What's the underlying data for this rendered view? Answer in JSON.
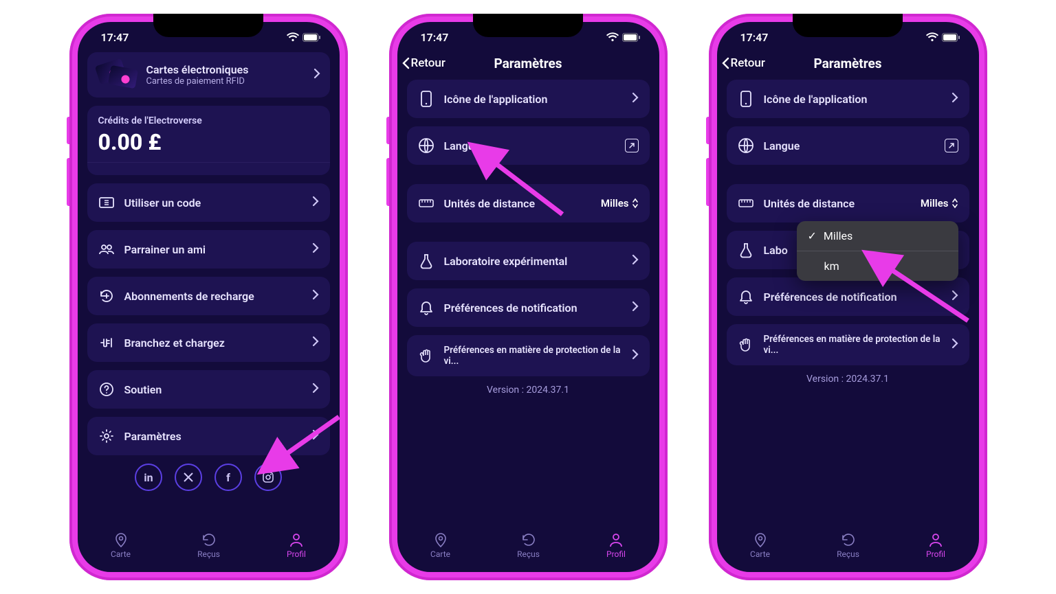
{
  "status": {
    "time": "17:47"
  },
  "tabbar": {
    "map": "Carte",
    "receipts": "Reçus",
    "profile": "Profil"
  },
  "screen1": {
    "ecards": {
      "title": "Cartes électroniques",
      "subtitle": "Cartes de paiement RFID"
    },
    "credits": {
      "label": "Crédits de l'Electroverse",
      "value": "0.00 £"
    },
    "redeem": "Utiliser un code",
    "refer": "Parrainer un ami",
    "subs": "Abonnements de recharge",
    "plug": "Branchez et chargez",
    "support": "Soutien",
    "settings": "Paramètres"
  },
  "settings": {
    "back": "Retour",
    "title": "Paramètres",
    "app_icon": "Icône de l'application",
    "language": "Langue",
    "distance_label": "Unités de distance",
    "distance_value": "Milles",
    "lab": "Laboratoire expérimental",
    "notif": "Préférences de notification",
    "privacy": "Préférences en matière de protection de la vi...",
    "version": "Version : 2024.37.1"
  },
  "screen3": {
    "lab_truncated": "Labo",
    "options": {
      "miles": "Milles",
      "km": "km"
    }
  }
}
